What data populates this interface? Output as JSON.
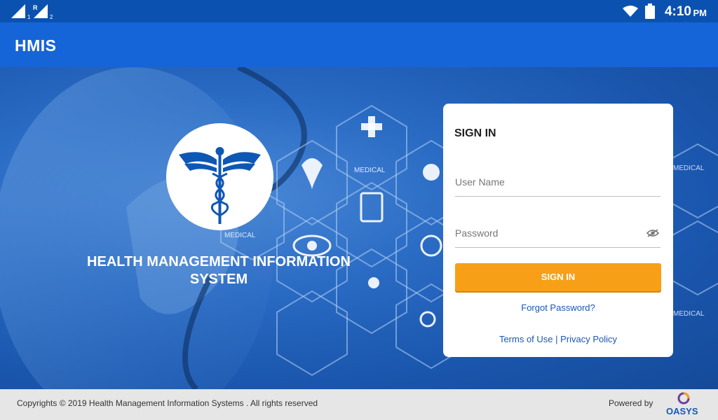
{
  "status_bar": {
    "time": "4:10",
    "ampm": "PM",
    "sim1_label": "1",
    "sim_r_label": "R",
    "sim2_label": "2"
  },
  "app_bar": {
    "title": "HMIS"
  },
  "hero": {
    "title": "HEALTH MANAGEMENT INFORMATION SYSTEM",
    "hex_labels": [
      "MEDICAL",
      "MEDICAL",
      "MEDICAL",
      "MEDICAL"
    ]
  },
  "signin": {
    "heading": "SIGN IN",
    "username_placeholder": "User Name",
    "password_placeholder": "Password",
    "button_label": "SIGN IN",
    "forgot_password": "Forgot Password?",
    "terms_of_use": "Terms of Use",
    "separator": " | ",
    "privacy_policy": "Privacy Policy"
  },
  "footer": {
    "copyright": "Copyrights © 2019 Health Management Information Systems . All rights reserved",
    "powered_by": "Powered by",
    "brand": "OASYS"
  },
  "colors": {
    "status_bar": "#0b52b0",
    "app_bar": "#1565d8",
    "button": "#f7a017",
    "link": "#1a56b8",
    "footer": "#e6e6e6"
  }
}
